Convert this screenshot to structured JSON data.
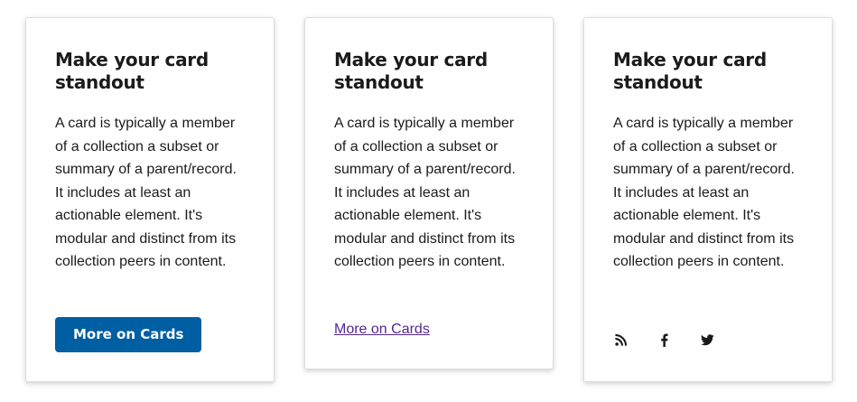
{
  "cards": [
    {
      "title": "Make your card standout",
      "body": "A card is typically a member of a collection a subset or summary of a parent/record. It includes at least an actionable element. It's modular and distinct from its collection peers in content.",
      "action_label": "More on Cards"
    },
    {
      "title": "Make your card standout",
      "body": "A card is typically a member of a collection a subset or summary of a parent/record. It includes at least an actionable element. It's modular and distinct from its collection peers in content.",
      "action_label": "More on Cards"
    },
    {
      "title": "Make your card standout",
      "body": "A card is typically a member of a collection a subset or summary of a parent/record. It includes at least an actionable element. It's modular and distinct from its collection peers in content.",
      "social_icons": [
        "rss-icon",
        "facebook-icon",
        "twitter-icon"
      ]
    }
  ],
  "colors": {
    "primary_button": "#005ea2",
    "link": "#54278f",
    "text": "#1b1b1b"
  }
}
